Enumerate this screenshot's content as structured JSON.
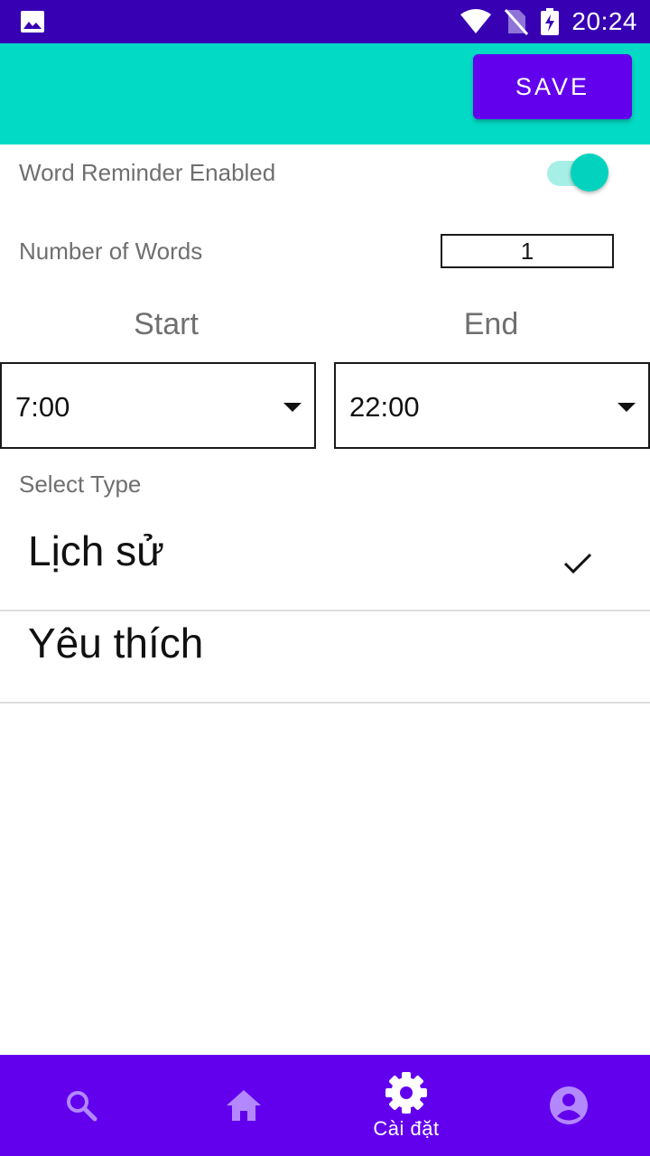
{
  "status_bar": {
    "time": "20:24",
    "icons": [
      "image-icon",
      "wifi-icon",
      "no-sim-icon",
      "battery-charging-icon"
    ]
  },
  "app_bar": {
    "save_label": "SAVE"
  },
  "settings": {
    "reminder_label": "Word Reminder Enabled",
    "reminder_enabled": true,
    "words_label": "Number of Words",
    "words_value": "1",
    "start_label": "Start",
    "end_label": "End",
    "start_value": "7:00",
    "end_value": "22:00",
    "type_label": "Select Type",
    "types": [
      {
        "label": "Lịch sử",
        "selected": true
      },
      {
        "label": "Yêu thích",
        "selected": false
      }
    ]
  },
  "bottom_nav": {
    "items": [
      {
        "icon": "search-icon",
        "label": "",
        "active": false
      },
      {
        "icon": "home-icon",
        "label": "",
        "active": false
      },
      {
        "icon": "gear-icon",
        "label": "Cài đặt",
        "active": true
      },
      {
        "icon": "account-icon",
        "label": "",
        "active": false
      }
    ]
  },
  "colors": {
    "status_bar": "#3700b3",
    "app_bar": "#03dac5",
    "primary": "#6200ee",
    "toggle_on": "#03d3be",
    "inactive_icon": "#b388ff"
  }
}
